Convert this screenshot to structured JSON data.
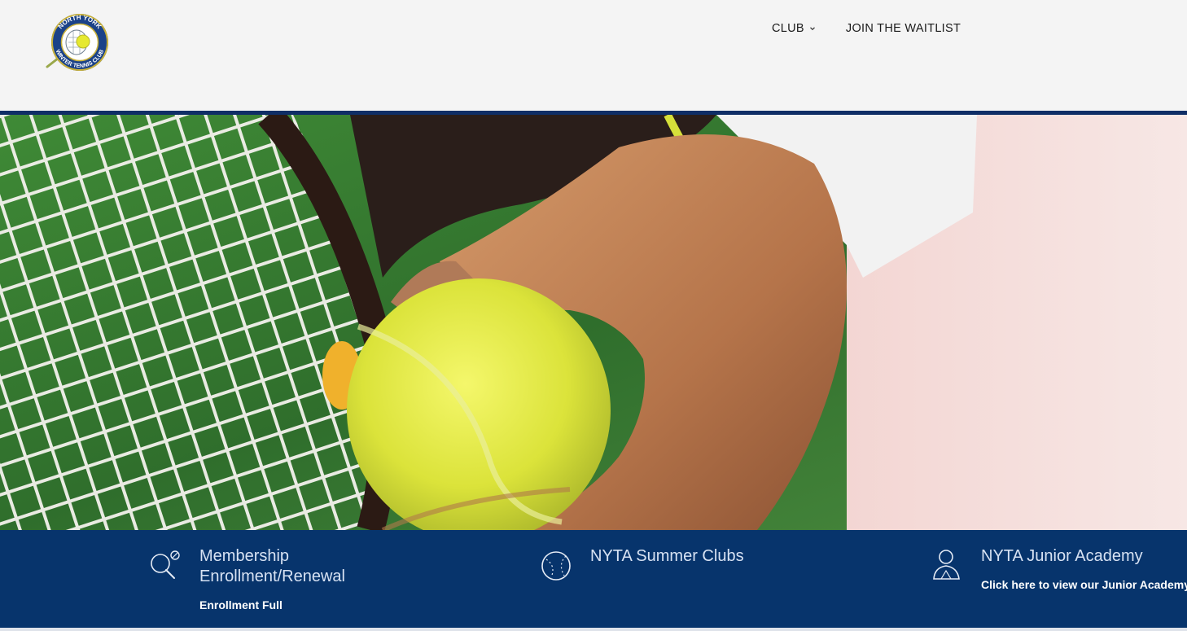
{
  "logo": {
    "text_top": "NORTH YORK",
    "text_bottom": "WINTER TENNIS CLUB"
  },
  "nav": {
    "items": [
      {
        "label": "CLUB",
        "has_dropdown": true
      },
      {
        "label": "JOIN THE WAITLIST",
        "has_dropdown": false
      }
    ]
  },
  "hero": {
    "image": "tennis-racket-and-ball-photo"
  },
  "features": [
    {
      "icon": "search-tennis-icon",
      "title_line1": "Membership",
      "title_line2": "Enrollment/Renewal",
      "subtitle": "Enrollment Full"
    },
    {
      "icon": "tennis-ball-outline-icon",
      "title_line1": "NYTA Summer Clubs",
      "title_line2": "",
      "subtitle": ""
    },
    {
      "icon": "user-icon",
      "title_line1": "NYTA Junior Academy",
      "title_line2": "",
      "subtitle": "Click here to view our Junior Academy"
    }
  ],
  "colors": {
    "header_bg": "#f4f4f4",
    "accent_navy": "#07346c",
    "rule": "#0f2e66",
    "title_text": "#d7e2f3"
  }
}
